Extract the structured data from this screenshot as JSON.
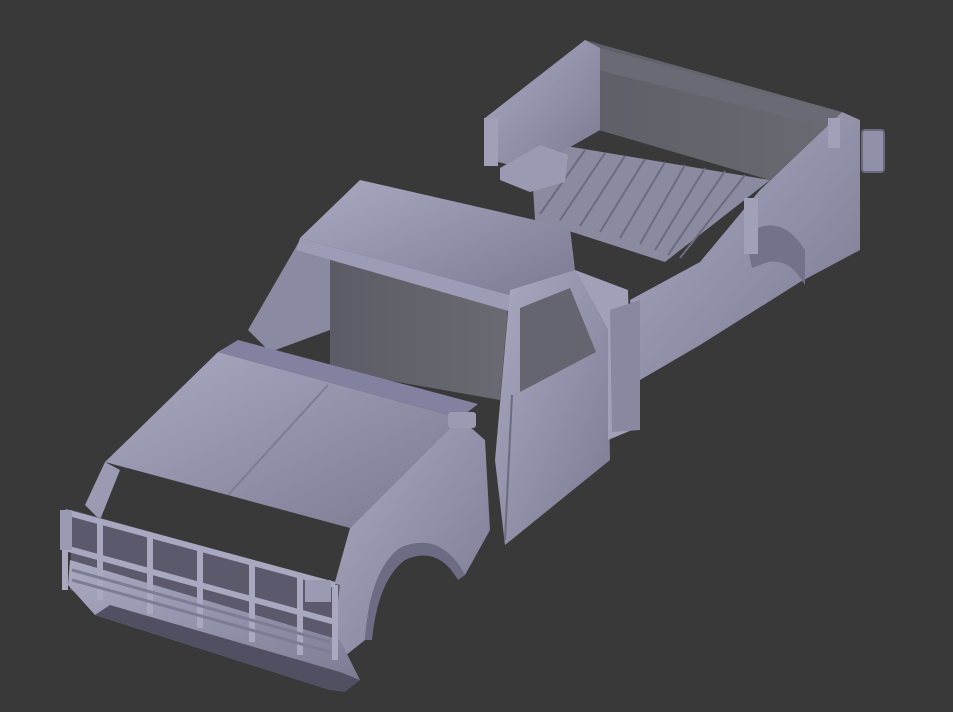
{
  "viewport": {
    "background_color": "#393939",
    "model_color": "#8c8ca4",
    "model_highlight_color": "#a4a4bc",
    "model_shadow_color": "#5e5e70"
  },
  "model": {
    "components": [
      "truck-bed",
      "truck-cab",
      "hood",
      "front-grille",
      "front-fender",
      "rear-fender"
    ]
  }
}
